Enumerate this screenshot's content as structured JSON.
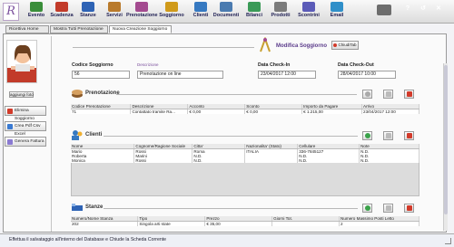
{
  "toolbar": {
    "items": [
      {
        "label": "Evento",
        "color": "#3a8e3a"
      },
      {
        "label": "Scadenza",
        "color": "#c23b2a"
      },
      {
        "label": "Stanze",
        "color": "#2e63b5"
      },
      {
        "label": "Servizi",
        "color": "#b97a2c"
      },
      {
        "label": "Prenotazione",
        "color": "#a34a8f"
      },
      {
        "label": "Soggiorno",
        "color": "#d09a1a"
      },
      {
        "label": "Clienti",
        "color": "#3679c1"
      },
      {
        "label": "Documenti",
        "color": "#4b7bb0"
      },
      {
        "label": "Bilanci",
        "color": "#3a9a57"
      },
      {
        "label": "Prodotti",
        "color": "#7b7b7b"
      },
      {
        "label": "Scontrini",
        "color": "#5b5bb8"
      },
      {
        "label": "Email",
        "color": "#2f8fc9"
      }
    ],
    "sys_buttons": [
      {
        "glyph": "?",
        "color": "#3c6fcf"
      },
      {
        "glyph": "↺",
        "color": "#3c6fcf"
      },
      {
        "glyph": "✕",
        "color": "#3c6fcf"
      }
    ]
  },
  "tabs": [
    {
      "label": "Ricettiva Home"
    },
    {
      "label": "Mostra Tutti Prenotazione"
    },
    {
      "label": "Nuova Creazione Soggiorno"
    }
  ],
  "sidebar": {
    "upload_label": "aggiungi foto",
    "buttons": [
      {
        "label": "Elimina Soggiorno",
        "color": "#d23a2a"
      },
      {
        "label": "Crea Pdf Csv Excel",
        "color": "#3a7ad2"
      },
      {
        "label": "Genera Fattura",
        "color": "#8a7ad2"
      }
    ]
  },
  "header": {
    "title": "Modifica Soggiorno",
    "close_label": "ChiudiTab"
  },
  "fields": {
    "codice_label": "Codice Soggiorno",
    "codice_value": "56",
    "descrizione_label": "Descrizione",
    "descrizione_value": "Prenotazione on line",
    "checkin_label": "Data Check-In",
    "checkin_value": "23/04/2017 12:00",
    "checkout_label": "Data Check-Out",
    "checkout_value": "28/04/2017 10:00"
  },
  "prenotazione": {
    "title": "Prenotazione",
    "columns": [
      "Codice Prenotazione",
      "Descrizione",
      "Acconto",
      "Sconto",
      "Importo da Pagare",
      "Arrivo"
    ],
    "rows": [
      [
        "71",
        "Contattato tramite Ra...",
        "€ 0,00",
        "€ 0,00",
        "€ 1.215,00",
        "23/04/2017 12:00"
      ]
    ]
  },
  "clienti": {
    "title": "Clienti",
    "columns": [
      "Nome",
      "Cognome/Ragione Sociale",
      "Citta'",
      "Nazionalita' (Stato)",
      "Cellulare",
      "Note"
    ],
    "rows": [
      [
        "Mario",
        "Rossi",
        "Roma",
        "ITALIA",
        "336-7845127",
        "N.D."
      ],
      [
        "Roberta",
        "Marini",
        "N.D.",
        "",
        "N.D.",
        "N.D."
      ],
      [
        "Monica",
        "Rossi",
        "N.D.",
        "",
        "N.D.",
        "N.D."
      ]
    ]
  },
  "stanze": {
    "title": "Stanze",
    "columns": [
      "Numero/Nome Stanza",
      "Tipo",
      "Prezzo",
      "Giorni Tot.",
      "Numero Massimo Posti Letto"
    ],
    "rows": [
      [
        "202",
        "Singola arti state",
        "€ 35,00",
        "",
        "2"
      ]
    ]
  },
  "status": {
    "text": "Effettua il salvataggio all'interno del Database e Chiude la Scheda Corrente"
  }
}
